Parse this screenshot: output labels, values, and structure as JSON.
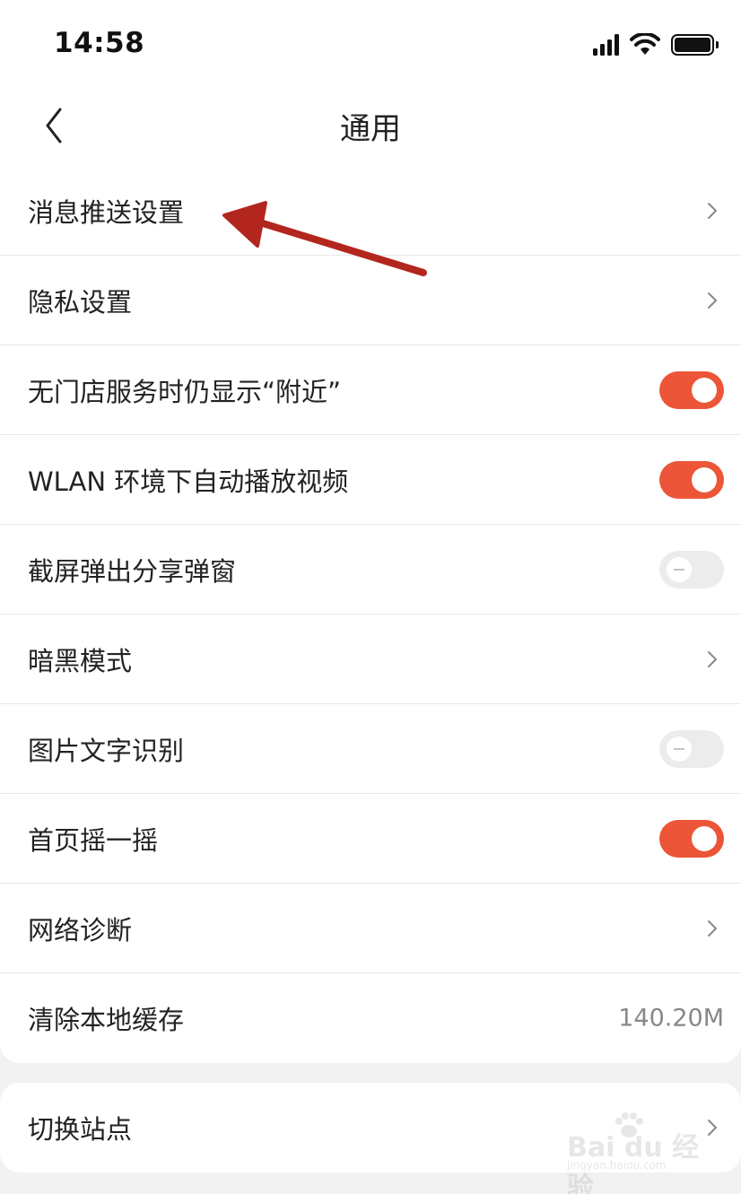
{
  "status_bar": {
    "time": "14:58"
  },
  "nav": {
    "title": "通用"
  },
  "settings": [
    {
      "label": "消息推送设置",
      "control": "chevron"
    },
    {
      "label": "隐私设置",
      "control": "chevron"
    },
    {
      "label": "无门店服务时仍显示“附近”",
      "control": "toggle",
      "on": true
    },
    {
      "label": "WLAN 环境下自动播放视频",
      "control": "toggle",
      "on": true
    },
    {
      "label": "截屏弹出分享弹窗",
      "control": "toggle",
      "on": false
    },
    {
      "label": "暗黑模式",
      "control": "chevron"
    },
    {
      "label": "图片文字识别",
      "control": "toggle",
      "on": false
    },
    {
      "label": "首页摇一摇",
      "control": "toggle",
      "on": true
    },
    {
      "label": "网络诊断",
      "control": "chevron"
    },
    {
      "label": "清除本地缓存",
      "control": "value",
      "value": "140.20M"
    }
  ],
  "secondary": [
    {
      "label": "切换站点",
      "control": "chevron"
    }
  ],
  "watermark": {
    "text": "Bai du 经验",
    "sub": "jingyan.baidu.com"
  },
  "colors": {
    "accent": "#ec5537",
    "annotation_arrow": "#b3261e",
    "toggle_off": "#ececec"
  },
  "icons": {
    "back": "chevron-left-icon",
    "row_chevron": "chevron-right-icon",
    "wifi": "wifi-icon",
    "signal": "cellular-signal-icon",
    "battery": "battery-icon"
  }
}
